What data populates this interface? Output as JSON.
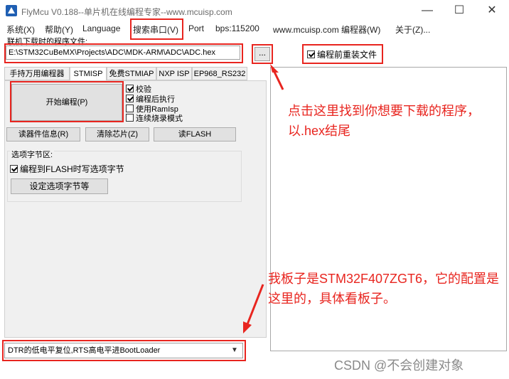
{
  "window": {
    "title": "FlyMcu V0.188--单片机在线编程专家--www.mcuisp.com",
    "minimize": "—",
    "maximize": "☐",
    "close": "✕"
  },
  "menu": {
    "items": [
      "系统(X)",
      "帮助(Y)",
      "Language",
      "搜索串口(V)",
      "Port",
      "bps:115200",
      "www.mcuisp.com 编程器(W)",
      "关于(Z)..."
    ]
  },
  "file": {
    "label": "联机下载时的程序文件:",
    "path": "E:\\STM32CuBeMX\\Projects\\ADC\\MDK-ARM\\ADC\\ADC.hex",
    "browse": "...",
    "reload_label": "编程前重装文件",
    "reload_checked": true
  },
  "tabs": [
    "手持万用编程器",
    "STMISP",
    "免费STMIAP",
    "NXP ISP",
    "EP968_RS232"
  ],
  "actions": {
    "start": "开始编程(P)",
    "read_info": "读器件信息(R)",
    "erase": "清除芯片(Z)",
    "read_flash": "读FLASH"
  },
  "checks": [
    {
      "label": "校验",
      "checked": true
    },
    {
      "label": "编程后执行",
      "checked": true
    },
    {
      "label": "使用RamIsp",
      "checked": false
    },
    {
      "label": "连续烧录模式",
      "checked": false
    }
  ],
  "option_bytes": {
    "title": "选项字节区:",
    "write_label": "编程到FLASH时写选项字节",
    "write_checked": true,
    "set_button": "设定选项字节等"
  },
  "reset_mode": "DTR的低电平复位,RTS高电平进BootLoader",
  "annotations": {
    "note1": "点击这里找到你想要下载的程序，以.hex结尾",
    "note2": "我板子是STM32F407ZGT6，它的配置是这里的，具体看板子。"
  },
  "watermark": "CSDN @不会创建对象",
  "colors": {
    "annotation": "#e8251f"
  }
}
